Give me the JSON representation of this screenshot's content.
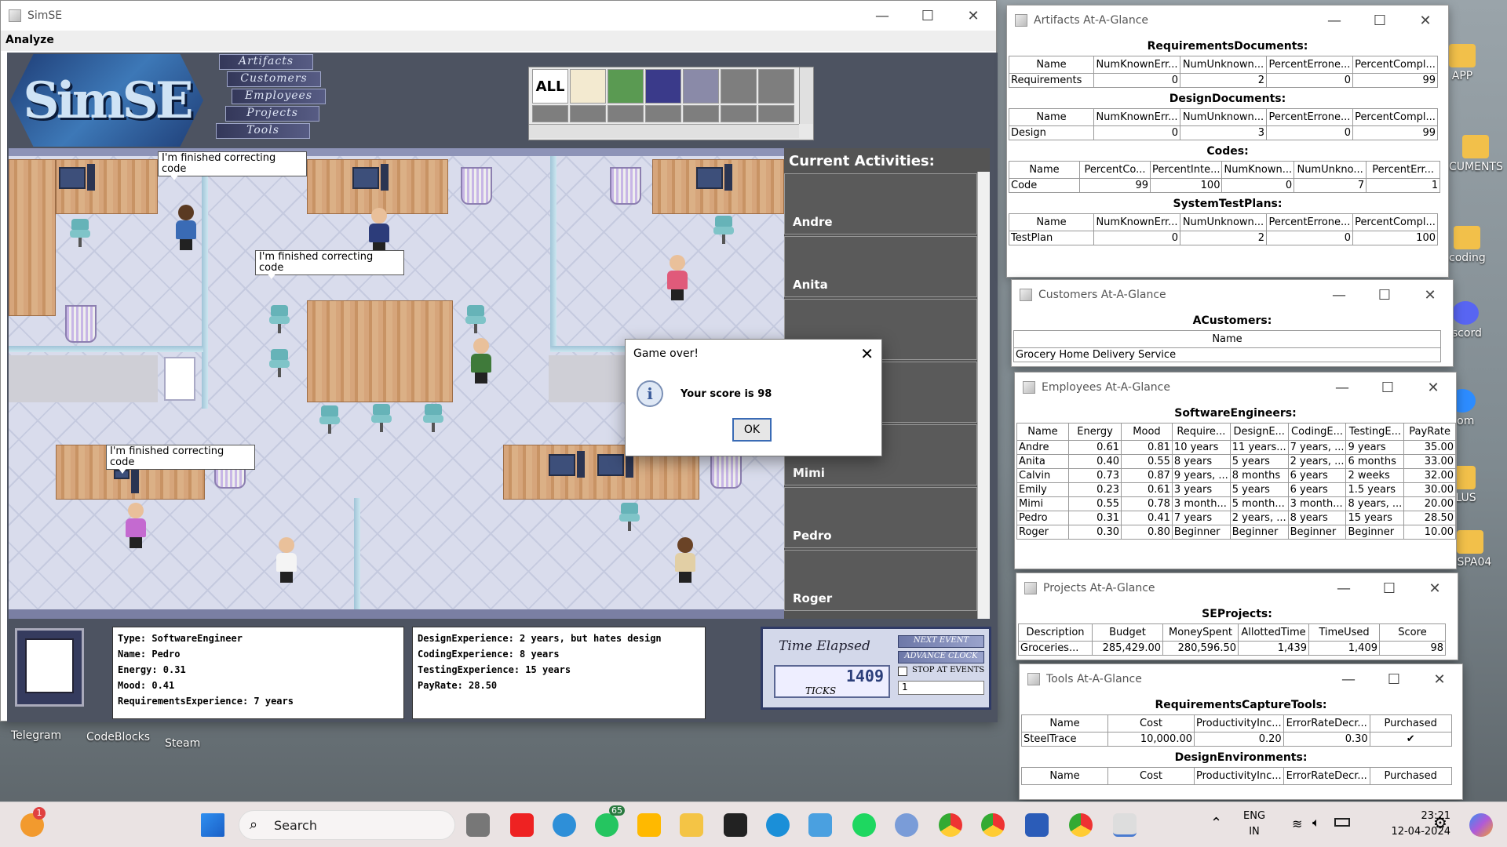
{
  "desktop": {
    "icons_right": [
      "APP",
      "CUMENTS",
      "coding",
      "iscord",
      "oom",
      "PLUS",
      "NSPA04"
    ],
    "icons_bottom": [
      "Telegram",
      "CodeBlocks",
      "Steam"
    ]
  },
  "simse": {
    "title": "SimSE",
    "menu": "Analyze",
    "logo_text": "SimSE",
    "nav": [
      "Artifacts",
      "Customers",
      "Employees",
      "Projects",
      "Tools"
    ],
    "palette_all": "ALL",
    "bubbles": [
      "I'm finished correcting code",
      "I'm finished correcting code",
      "I'm finished correcting code"
    ],
    "activities_title": "Current Activities:",
    "activities": [
      "Andre",
      "Anita",
      "",
      "",
      "Mimi",
      "Pedro",
      "Roger"
    ],
    "info_left": [
      "Type: SoftwareEngineer",
      "Name: Pedro",
      "Energy: 0.31",
      "Mood: 0.41",
      "RequirementsExperience: 7 years"
    ],
    "info_right": [
      "DesignExperience: 2 years, but hates design",
      "CodingExperience: 8 years",
      "TestingExperience: 15 years",
      "PayRate: 28.50"
    ],
    "clock": {
      "label": "Time Elapsed",
      "ticks_value": "1409",
      "ticks_label": "TICKS",
      "next_event": "NEXT EVENT",
      "advance_clock": "ADVANCE CLOCK",
      "stop_at_events": "STOP AT EVENTS",
      "advance_input": "1"
    }
  },
  "dialog": {
    "title": "Game over!",
    "message": "Your score is 98",
    "ok": "OK"
  },
  "artifacts": {
    "title": "Artifacts At-A-Glance",
    "sections": [
      {
        "name": "RequirementsDocuments:",
        "cols": [
          "Name",
          "NumKnownErr...",
          "NumUnknown...",
          "PercentErrone...",
          "PercentCompl..."
        ],
        "rows": [
          [
            "Requirements",
            "0",
            "2",
            "0",
            "99"
          ]
        ]
      },
      {
        "name": "DesignDocuments:",
        "cols": [
          "Name",
          "NumKnownErr...",
          "NumUnknown...",
          "PercentErrone...",
          "PercentCompl..."
        ],
        "rows": [
          [
            "Design",
            "0",
            "3",
            "0",
            "99"
          ]
        ]
      },
      {
        "name": "Codes:",
        "cols": [
          "Name",
          "PercentCo...",
          "PercentInte...",
          "NumKnown...",
          "NumUnkno...",
          "PercentErr..."
        ],
        "rows": [
          [
            "Code",
            "99",
            "100",
            "0",
            "7",
            "1"
          ]
        ]
      },
      {
        "name": "SystemTestPlans:",
        "cols": [
          "Name",
          "NumKnownErr...",
          "NumUnknown...",
          "PercentErrone...",
          "PercentCompl..."
        ],
        "rows": [
          [
            "TestPlan",
            "0",
            "2",
            "0",
            "100"
          ]
        ]
      }
    ]
  },
  "customers": {
    "title": "Customers At-A-Glance",
    "section": "ACustomers:",
    "cols": [
      "Name"
    ],
    "rows": [
      [
        "Grocery Home Delivery Service"
      ]
    ]
  },
  "employees": {
    "title": "Employees At-A-Glance",
    "section": "SoftwareEngineers:",
    "cols": [
      "Name",
      "Energy",
      "Mood",
      "Require...",
      "DesignE...",
      "CodingE...",
      "TestingE...",
      "PayRate"
    ],
    "rows": [
      [
        "Andre",
        "0.61",
        "0.81",
        "10 years",
        "11 years...",
        "7 years, ...",
        "9 years",
        "35.00"
      ],
      [
        "Anita",
        "0.40",
        "0.55",
        "8 years",
        "5 years",
        "2 years, ...",
        "6 months",
        "33.00"
      ],
      [
        "Calvin",
        "0.73",
        "0.87",
        "9 years, ...",
        "8 months",
        "6 years",
        "2 weeks",
        "32.00"
      ],
      [
        "Emily",
        "0.23",
        "0.61",
        "3 years",
        "5 years",
        "6 years",
        "1.5 years",
        "30.00"
      ],
      [
        "Mimi",
        "0.55",
        "0.78",
        "3 month...",
        "5 month...",
        "3 month...",
        "8 years, ...",
        "20.00"
      ],
      [
        "Pedro",
        "0.31",
        "0.41",
        "7 years",
        "2 years, ...",
        "8 years",
        "15 years",
        "28.50"
      ],
      [
        "Roger",
        "0.30",
        "0.80",
        "Beginner",
        "Beginner",
        "Beginner",
        "Beginner",
        "10.00"
      ]
    ]
  },
  "projects": {
    "title": "Projects At-A-Glance",
    "section": "SEProjects:",
    "cols": [
      "Description",
      "Budget",
      "MoneySpent",
      "AllottedTime",
      "TimeUsed",
      "Score"
    ],
    "rows": [
      [
        "Groceries...",
        "285,429.00",
        "280,596.50",
        "1,439",
        "1,409",
        "98"
      ]
    ]
  },
  "tools": {
    "title": "Tools At-A-Glance",
    "sections": [
      {
        "name": "RequirementsCaptureTools:",
        "cols": [
          "Name",
          "Cost",
          "ProductivityInc...",
          "ErrorRateDecr...",
          "Purchased"
        ],
        "rows": [
          [
            "SteelTrace",
            "10,000.00",
            "0.20",
            "0.30",
            "✔"
          ]
        ]
      },
      {
        "name": "DesignEnvironments:",
        "cols": [
          "Name",
          "Cost",
          "ProductivityInc...",
          "ErrorRateDecr...",
          "Purchased"
        ],
        "rows": []
      }
    ]
  },
  "taskbar": {
    "search_label": "Search",
    "notif_badge": "1",
    "whatsapp_badge": "65",
    "lang_top": "ENG",
    "lang_bottom": "IN",
    "time": "23:21",
    "date": "12-04-2024"
  },
  "colors": {
    "game_bg": "#4d5361",
    "floor": "#d9dcec",
    "accent": "#3a6bb5"
  }
}
